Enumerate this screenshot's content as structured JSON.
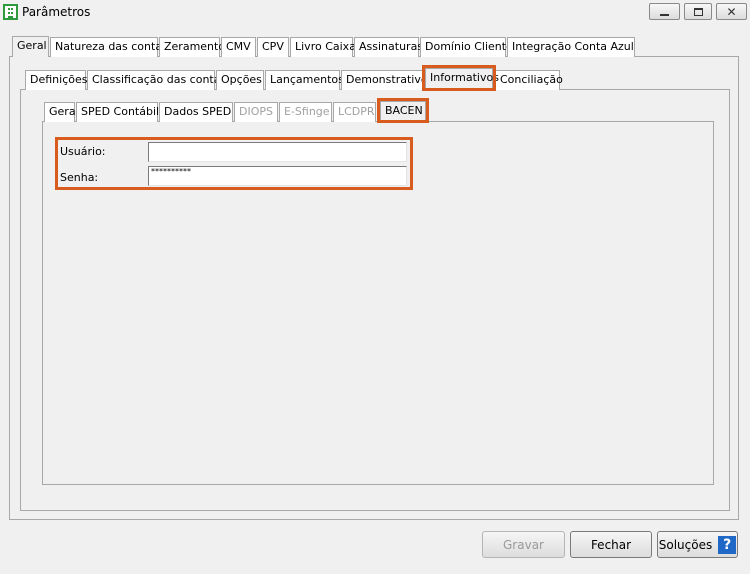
{
  "window": {
    "title": "Parâmetros",
    "controls": [
      "minimize",
      "maximize",
      "close"
    ]
  },
  "tabs_level1": [
    {
      "label": "Geral",
      "selected": true
    },
    {
      "label": "Natureza das contas"
    },
    {
      "label": "Zeramento"
    },
    {
      "label": "CMV"
    },
    {
      "label": "CPV"
    },
    {
      "label": "Livro Caixa"
    },
    {
      "label": "Assinaturas"
    },
    {
      "label": "Domínio Cliente"
    },
    {
      "label": "Integração Conta Azul"
    }
  ],
  "tabs_level2": [
    {
      "label": "Definições"
    },
    {
      "label": "Classificação das contas"
    },
    {
      "label": "Opções"
    },
    {
      "label": "Lançamentos"
    },
    {
      "label": "Demonstrativos"
    },
    {
      "label": "Informativos",
      "selected": true,
      "highlighted": true
    },
    {
      "label": "Conciliação"
    }
  ],
  "tabs_level3": [
    {
      "label": "Gera"
    },
    {
      "label": "SPED Contábil"
    },
    {
      "label": "Dados SPED"
    },
    {
      "label": "DIOPS",
      "disabled": true
    },
    {
      "label": "E-Sfinge",
      "disabled": true
    },
    {
      "label": "LCDPR",
      "disabled": true
    },
    {
      "label": "BACEN",
      "selected": true,
      "highlighted": true
    }
  ],
  "form": {
    "usuario_label": "Usuário:",
    "usuario_value": "",
    "senha_label": "Senha:",
    "senha_value": "**********"
  },
  "buttons": {
    "gravar": "Gravar",
    "fechar": "Fechar",
    "solucoes": "Soluções",
    "help_glyph": "?"
  },
  "colors": {
    "highlight": "#d85c1e",
    "help_icon": "#1f68c8"
  }
}
